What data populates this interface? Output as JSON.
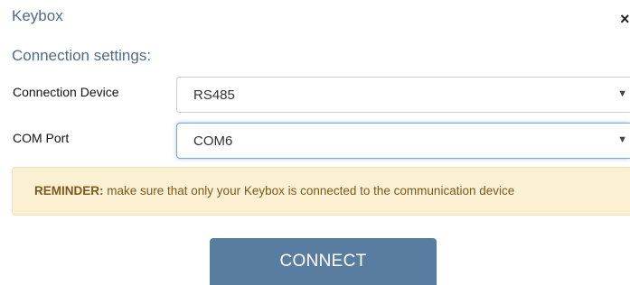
{
  "dialog": {
    "title": "Keybox",
    "close_glyph": "×"
  },
  "settings": {
    "heading": "Connection settings:",
    "connection_device": {
      "label": "Connection Device",
      "value": "RS485"
    },
    "com_port": {
      "label": "COM Port",
      "value": "COM6"
    }
  },
  "reminder": {
    "prefix": "REMINDER:",
    "text": " make sure that only your Keybox is connected to the communication device"
  },
  "actions": {
    "connect_label": "CONNECT"
  },
  "colors": {
    "heading": "#4f6b8a",
    "button": "#597da0",
    "reminder_bg": "#fcf0d2",
    "reminder_text": "#7a5a1f"
  },
  "icons": {
    "close": "close-icon",
    "dropdown": "chevron-down-icon"
  }
}
